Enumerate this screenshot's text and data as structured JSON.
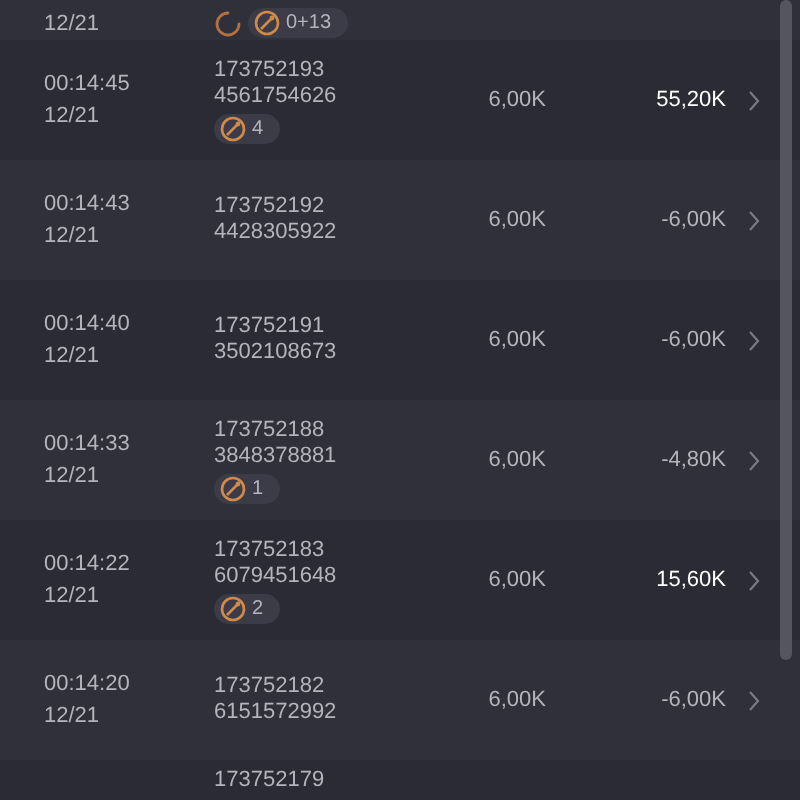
{
  "rows": [
    {
      "date": "12/21",
      "loading": true,
      "badge": "0+13"
    },
    {
      "time": "00:14:45",
      "date": "12/21",
      "id": "173752193",
      "ref": "4561754626",
      "loading": false,
      "badge": "4",
      "bet": "6,00K",
      "result": "55,20K",
      "positive": true
    },
    {
      "time": "00:14:43",
      "date": "12/21",
      "id": "173752192",
      "ref": "4428305922",
      "loading": false,
      "bet": "6,00K",
      "result": "-6,00K",
      "positive": false
    },
    {
      "time": "00:14:40",
      "date": "12/21",
      "id": "173752191",
      "ref": "3502108673",
      "loading": false,
      "bet": "6,00K",
      "result": "-6,00K",
      "positive": false
    },
    {
      "time": "00:14:33",
      "date": "12/21",
      "id": "173752188",
      "ref": "3848378881",
      "loading": false,
      "badge": "1",
      "bet": "6,00K",
      "result": "-4,80K",
      "positive": false
    },
    {
      "time": "00:14:22",
      "date": "12/21",
      "id": "173752183",
      "ref": "6079451648",
      "loading": false,
      "badge": "2",
      "bet": "6,00K",
      "result": "15,60K",
      "positive": true
    },
    {
      "time": "00:14:20",
      "date": "12/21",
      "id": "173752182",
      "ref": "6151572992",
      "loading": false,
      "bet": "6,00K",
      "result": "-6,00K",
      "positive": false
    },
    {
      "id": "173752179",
      "loading": false
    }
  ]
}
